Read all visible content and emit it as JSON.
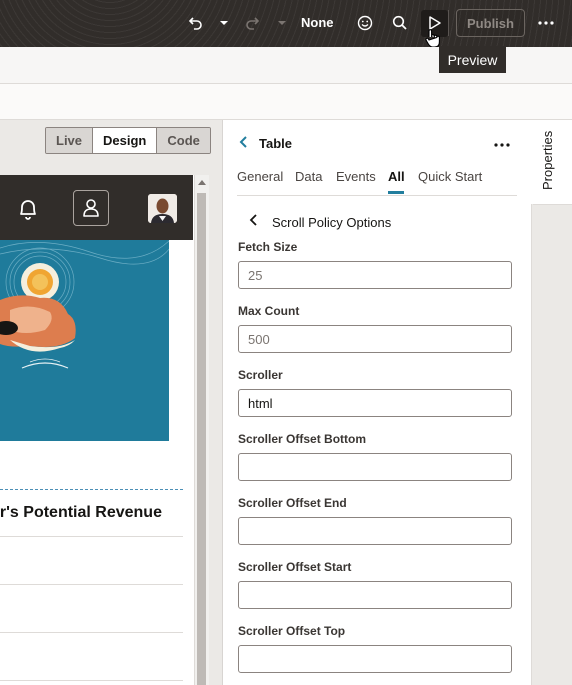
{
  "topbar": {
    "undo_icon": "undo-icon",
    "redo_icon": "redo-icon",
    "none_label": "None",
    "emoji_icon": "smiley-icon",
    "search_icon": "search-icon",
    "preview_icon": "play-icon",
    "publish_label": "Publish",
    "more_icon": "ellipsis-icon"
  },
  "tooltip": {
    "text": "Preview"
  },
  "canvas": {
    "modes": [
      "Live",
      "Design",
      "Code"
    ],
    "active_mode": "Design",
    "table_title": "ar's Potential Revenue"
  },
  "properties": {
    "side_tab": "Properties",
    "title": "Table",
    "tabs": [
      "General",
      "Data",
      "Events",
      "All",
      "Quick Start"
    ],
    "active_tab": "All",
    "section_title": "Scroll Policy Options",
    "fields": [
      {
        "label": "Fetch Size",
        "placeholder": "25",
        "value": ""
      },
      {
        "label": "Max Count",
        "placeholder": "500",
        "value": ""
      },
      {
        "label": "Scroller",
        "placeholder": "",
        "value": "html"
      },
      {
        "label": "Scroller Offset Bottom",
        "placeholder": "",
        "value": ""
      },
      {
        "label": "Scroller Offset End",
        "placeholder": "",
        "value": ""
      },
      {
        "label": "Scroller Offset Start",
        "placeholder": "",
        "value": ""
      },
      {
        "label": "Scroller Offset Top",
        "placeholder": "",
        "value": ""
      }
    ]
  }
}
